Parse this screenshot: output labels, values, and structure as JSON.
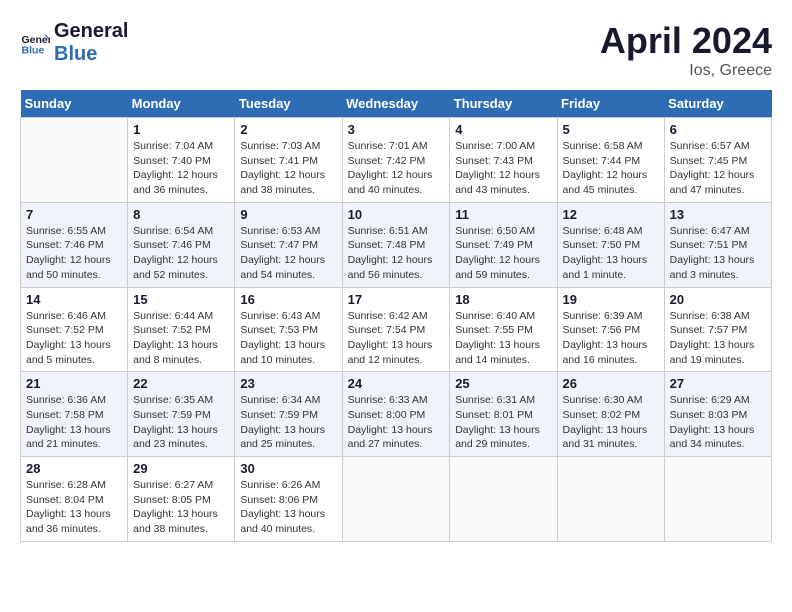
{
  "header": {
    "logo_line1": "General",
    "logo_line2": "Blue",
    "month_title": "April 2024",
    "location": "Ios, Greece"
  },
  "days_of_week": [
    "Sunday",
    "Monday",
    "Tuesday",
    "Wednesday",
    "Thursday",
    "Friday",
    "Saturday"
  ],
  "weeks": [
    [
      {
        "day": "",
        "info": ""
      },
      {
        "day": "1",
        "info": "Sunrise: 7:04 AM\nSunset: 7:40 PM\nDaylight: 12 hours\nand 36 minutes."
      },
      {
        "day": "2",
        "info": "Sunrise: 7:03 AM\nSunset: 7:41 PM\nDaylight: 12 hours\nand 38 minutes."
      },
      {
        "day": "3",
        "info": "Sunrise: 7:01 AM\nSunset: 7:42 PM\nDaylight: 12 hours\nand 40 minutes."
      },
      {
        "day": "4",
        "info": "Sunrise: 7:00 AM\nSunset: 7:43 PM\nDaylight: 12 hours\nand 43 minutes."
      },
      {
        "day": "5",
        "info": "Sunrise: 6:58 AM\nSunset: 7:44 PM\nDaylight: 12 hours\nand 45 minutes."
      },
      {
        "day": "6",
        "info": "Sunrise: 6:57 AM\nSunset: 7:45 PM\nDaylight: 12 hours\nand 47 minutes."
      }
    ],
    [
      {
        "day": "7",
        "info": "Sunrise: 6:55 AM\nSunset: 7:46 PM\nDaylight: 12 hours\nand 50 minutes."
      },
      {
        "day": "8",
        "info": "Sunrise: 6:54 AM\nSunset: 7:46 PM\nDaylight: 12 hours\nand 52 minutes."
      },
      {
        "day": "9",
        "info": "Sunrise: 6:53 AM\nSunset: 7:47 PM\nDaylight: 12 hours\nand 54 minutes."
      },
      {
        "day": "10",
        "info": "Sunrise: 6:51 AM\nSunset: 7:48 PM\nDaylight: 12 hours\nand 56 minutes."
      },
      {
        "day": "11",
        "info": "Sunrise: 6:50 AM\nSunset: 7:49 PM\nDaylight: 12 hours\nand 59 minutes."
      },
      {
        "day": "12",
        "info": "Sunrise: 6:48 AM\nSunset: 7:50 PM\nDaylight: 13 hours\nand 1 minute."
      },
      {
        "day": "13",
        "info": "Sunrise: 6:47 AM\nSunset: 7:51 PM\nDaylight: 13 hours\nand 3 minutes."
      }
    ],
    [
      {
        "day": "14",
        "info": "Sunrise: 6:46 AM\nSunset: 7:52 PM\nDaylight: 13 hours\nand 5 minutes."
      },
      {
        "day": "15",
        "info": "Sunrise: 6:44 AM\nSunset: 7:52 PM\nDaylight: 13 hours\nand 8 minutes."
      },
      {
        "day": "16",
        "info": "Sunrise: 6:43 AM\nSunset: 7:53 PM\nDaylight: 13 hours\nand 10 minutes."
      },
      {
        "day": "17",
        "info": "Sunrise: 6:42 AM\nSunset: 7:54 PM\nDaylight: 13 hours\nand 12 minutes."
      },
      {
        "day": "18",
        "info": "Sunrise: 6:40 AM\nSunset: 7:55 PM\nDaylight: 13 hours\nand 14 minutes."
      },
      {
        "day": "19",
        "info": "Sunrise: 6:39 AM\nSunset: 7:56 PM\nDaylight: 13 hours\nand 16 minutes."
      },
      {
        "day": "20",
        "info": "Sunrise: 6:38 AM\nSunset: 7:57 PM\nDaylight: 13 hours\nand 19 minutes."
      }
    ],
    [
      {
        "day": "21",
        "info": "Sunrise: 6:36 AM\nSunset: 7:58 PM\nDaylight: 13 hours\nand 21 minutes."
      },
      {
        "day": "22",
        "info": "Sunrise: 6:35 AM\nSunset: 7:59 PM\nDaylight: 13 hours\nand 23 minutes."
      },
      {
        "day": "23",
        "info": "Sunrise: 6:34 AM\nSunset: 7:59 PM\nDaylight: 13 hours\nand 25 minutes."
      },
      {
        "day": "24",
        "info": "Sunrise: 6:33 AM\nSunset: 8:00 PM\nDaylight: 13 hours\nand 27 minutes."
      },
      {
        "day": "25",
        "info": "Sunrise: 6:31 AM\nSunset: 8:01 PM\nDaylight: 13 hours\nand 29 minutes."
      },
      {
        "day": "26",
        "info": "Sunrise: 6:30 AM\nSunset: 8:02 PM\nDaylight: 13 hours\nand 31 minutes."
      },
      {
        "day": "27",
        "info": "Sunrise: 6:29 AM\nSunset: 8:03 PM\nDaylight: 13 hours\nand 34 minutes."
      }
    ],
    [
      {
        "day": "28",
        "info": "Sunrise: 6:28 AM\nSunset: 8:04 PM\nDaylight: 13 hours\nand 36 minutes."
      },
      {
        "day": "29",
        "info": "Sunrise: 6:27 AM\nSunset: 8:05 PM\nDaylight: 13 hours\nand 38 minutes."
      },
      {
        "day": "30",
        "info": "Sunrise: 6:26 AM\nSunset: 8:06 PM\nDaylight: 13 hours\nand 40 minutes."
      },
      {
        "day": "",
        "info": ""
      },
      {
        "day": "",
        "info": ""
      },
      {
        "day": "",
        "info": ""
      },
      {
        "day": "",
        "info": ""
      }
    ]
  ]
}
